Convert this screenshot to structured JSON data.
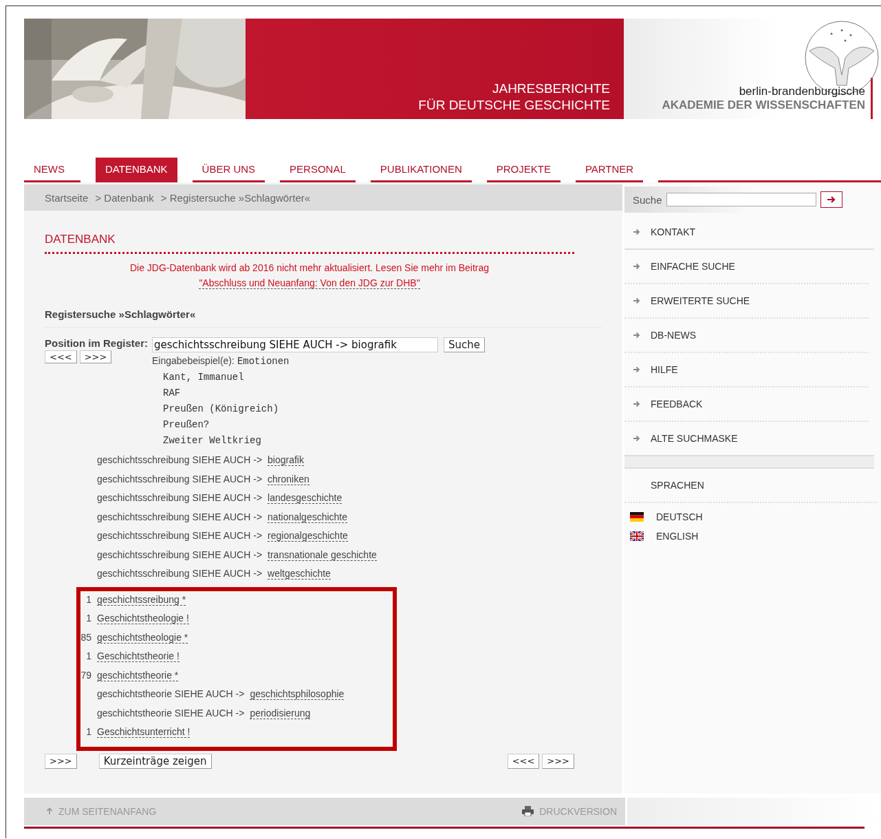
{
  "header": {
    "title_lines": [
      "JAHRESBERICHTE",
      "FÜR DEUTSCHE GESCHICHTE"
    ],
    "logo": {
      "line_1": "berlin-brandenburgische",
      "line_2": "AKADEMIE DER WISSENSCHAFTEN"
    }
  },
  "nav": [
    {
      "label": "NEWS",
      "selected": false
    },
    {
      "label": "DATENBANK",
      "selected": true
    },
    {
      "label": "ÜBER UNS",
      "selected": false
    },
    {
      "label": "PERSONAL",
      "selected": false
    },
    {
      "label": "PUBLIKATIONEN",
      "selected": false
    },
    {
      "label": "PROJEKTE",
      "selected": false
    },
    {
      "label": "PARTNER",
      "selected": false
    }
  ],
  "breadcrumb": [
    "Startseite",
    "> Datenbank",
    "> Registersuche »Schlagwörter«"
  ],
  "main": {
    "heading": "DATENBANK",
    "notice": {
      "text": "Die JDG-Datenbank wird ab 2016 nicht mehr aktualisiert. Lesen Sie mehr im Beitrag",
      "link": "\"Abschluss und Neuanfang: Von den JDG zur DHB\""
    },
    "subheading": "Registersuche »Schlagwörter«",
    "form": {
      "label": "Position im Register:",
      "value": "geschichtsschreibung SIEHE AUCH -> biografik",
      "submit": "Suche",
      "prev": "<<<",
      "next": ">>>",
      "example_label": "Eingabebeispiel(e):",
      "examples": [
        "Emotionen",
        "Kant, Immanuel",
        "RAF",
        "Preußen (Königreich)",
        "Preußen?",
        "Zweiter Weltkrieg"
      ]
    },
    "entries": [
      {
        "kind": "see_also",
        "text": "geschichtsschreibung SIEHE AUCH ->",
        "link": "biografik"
      },
      {
        "kind": "see_also",
        "text": "geschichtsschreibung SIEHE AUCH ->",
        "link": "chroniken"
      },
      {
        "kind": "see_also",
        "text": "geschichtsschreibung SIEHE AUCH ->",
        "link": "landesgeschichte"
      },
      {
        "kind": "see_also",
        "text": "geschichtsschreibung SIEHE AUCH ->",
        "link": "nationalgeschichte"
      },
      {
        "kind": "see_also",
        "text": "geschichtsschreibung SIEHE AUCH ->",
        "link": "regionalgeschichte"
      },
      {
        "kind": "see_also",
        "text": "geschichtsschreibung SIEHE AUCH ->",
        "link": "transnationale geschichte"
      },
      {
        "kind": "see_also",
        "text": "geschichtsschreibung SIEHE AUCH ->",
        "link": "weltgeschichte"
      }
    ],
    "highlighted_entries": [
      {
        "kind": "term",
        "count": "1",
        "link": "geschichtssreibung *"
      },
      {
        "kind": "term",
        "count": "1",
        "link": "Geschichtstheologie !"
      },
      {
        "kind": "term",
        "count": "85",
        "link": "geschichtstheologie *"
      },
      {
        "kind": "term",
        "count": "1",
        "link": "Geschichtstheorie !"
      },
      {
        "kind": "term",
        "count": "79",
        "link": "geschichtstheorie *"
      },
      {
        "kind": "see_also",
        "text": "geschichtstheorie SIEHE AUCH ->",
        "link": "geschichtsphilosophie"
      },
      {
        "kind": "see_also",
        "text": "geschichtstheorie SIEHE AUCH ->",
        "link": "periodisierung"
      },
      {
        "kind": "term",
        "count": "1",
        "link": "Geschichtsunterricht !"
      }
    ],
    "bottom_left": {
      "next": ">>>",
      "toggle": "Kurzeinträge zeigen"
    },
    "bottom_right": {
      "prev": "<<<",
      "next": ">>>"
    }
  },
  "sidebar": {
    "search_label": "Suche",
    "links": [
      "KONTAKT",
      "EINFACHE SUCHE",
      "ERWEITERTE SUCHE",
      "DB-NEWS",
      "HILFE",
      "FEEDBACK",
      "ALTE SUCHMASKE"
    ],
    "languages_heading": "SPRACHEN",
    "languages": [
      {
        "label": "DEUTSCH",
        "kind": "german"
      },
      {
        "label": "ENGLISH",
        "kind": "british"
      }
    ]
  },
  "footer": {
    "top_link": "ZUM SEITENANFANG",
    "print_link": "DRUCKVERSION"
  }
}
